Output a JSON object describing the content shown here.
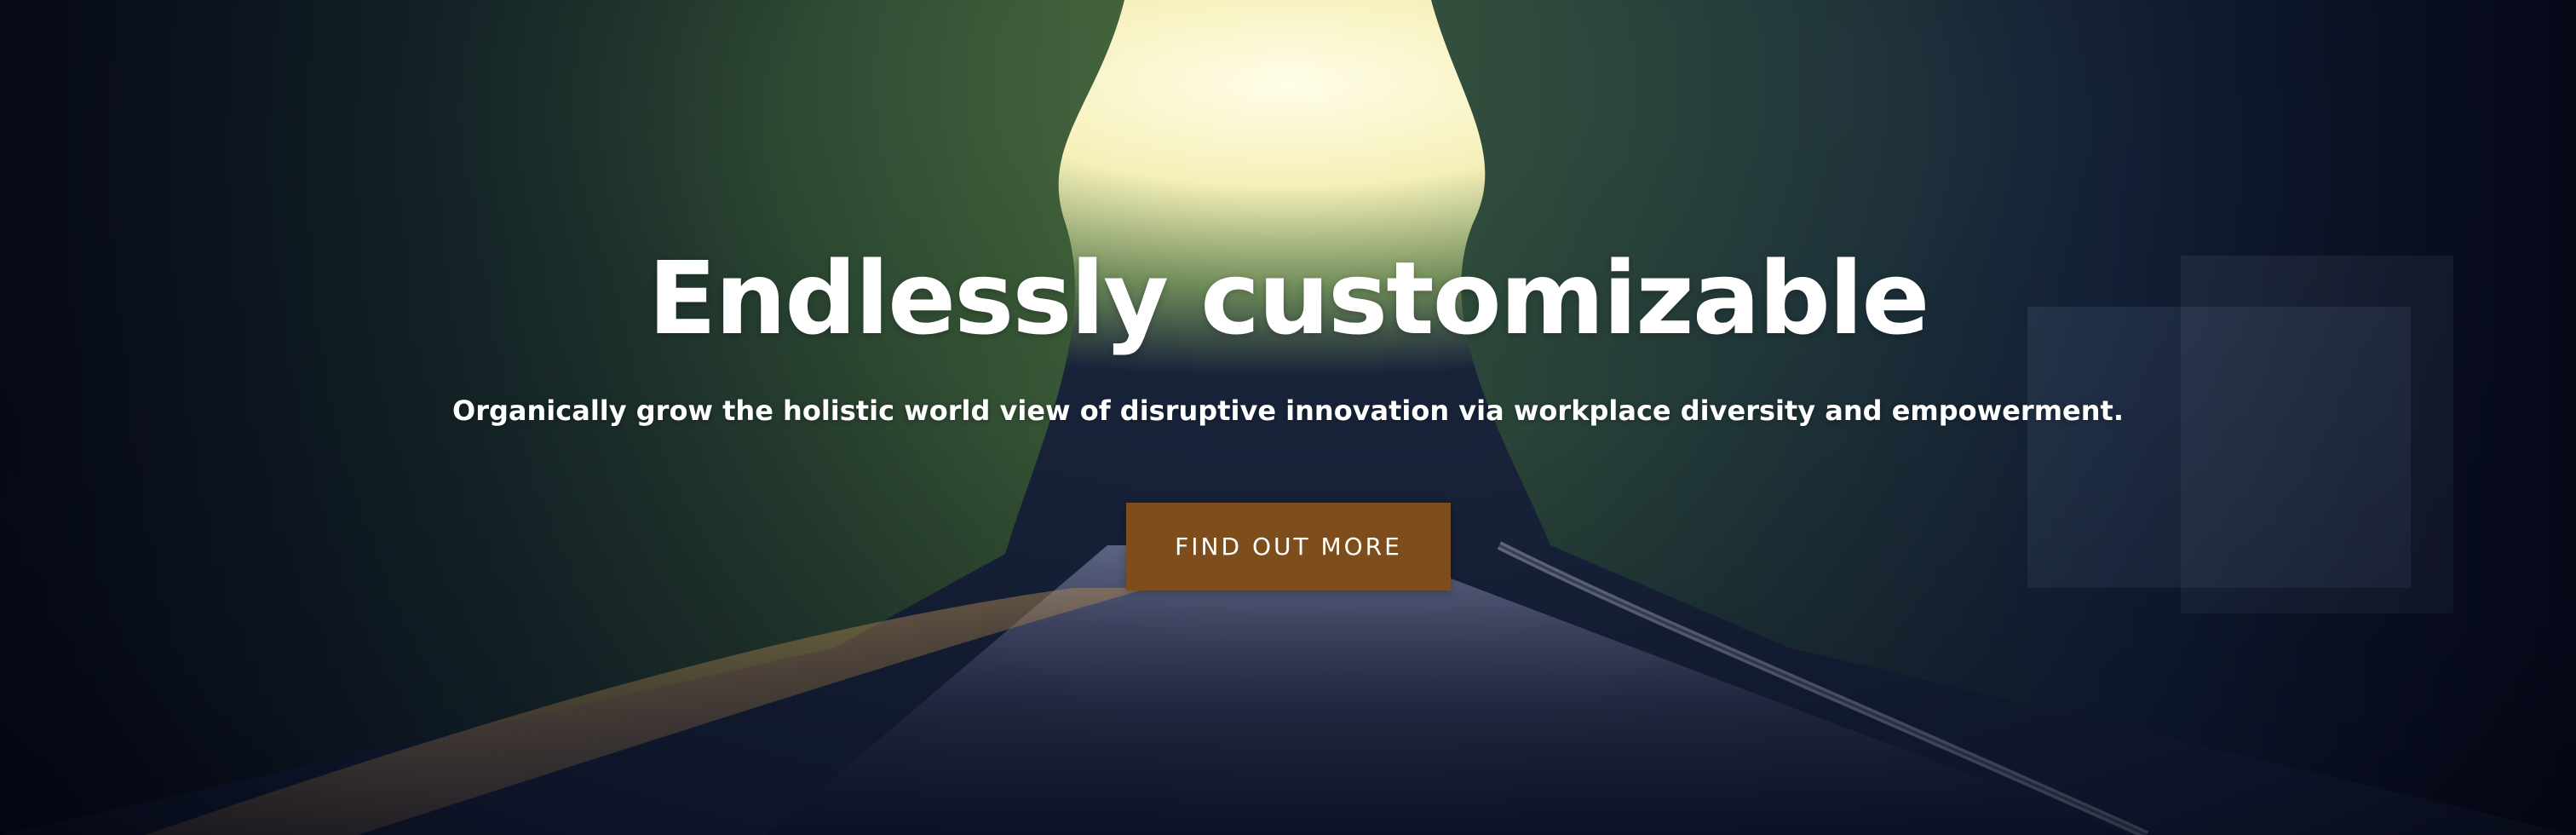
{
  "hero": {
    "title": "Endlessly customizable",
    "subtitle": "Organically grow the holistic world view of disruptive innovation via workplace diversity and empowerment.",
    "cta_label": "FIND OUT MORE",
    "background_image_name": "tree-lined-road-sunlight-photo"
  },
  "colors": {
    "cta_background": "#7d4e1b",
    "text": "#ffffff",
    "sky_highlight": "#fff8c8"
  }
}
